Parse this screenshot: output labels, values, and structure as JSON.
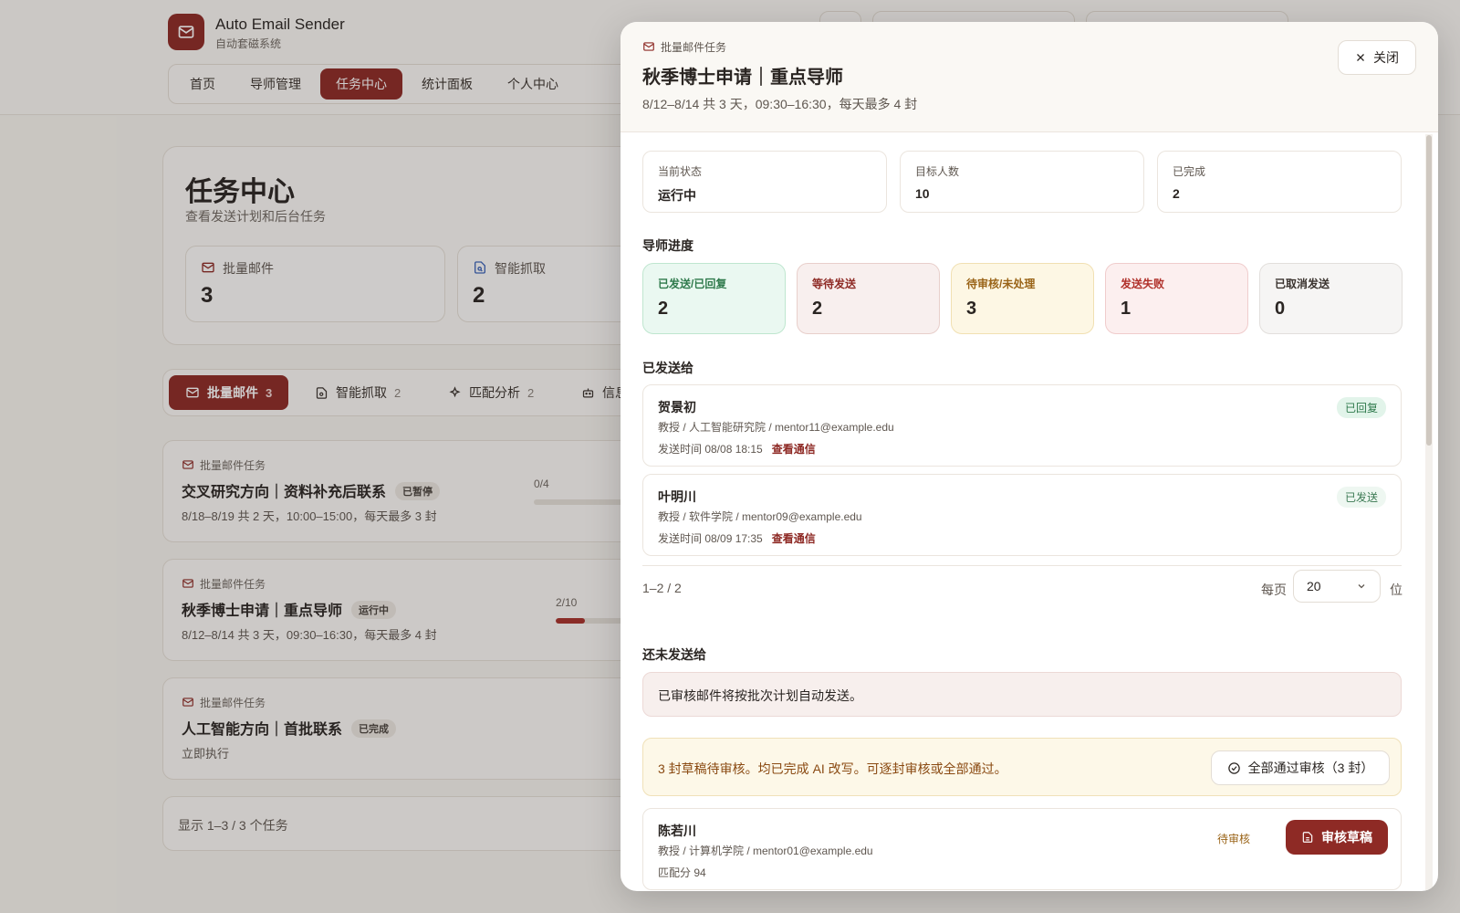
{
  "app": {
    "title": "Auto Email Sender",
    "subtitle": "自动套磁系统"
  },
  "nav": {
    "items": [
      "首页",
      "导师管理",
      "任务中心",
      "统计面板",
      "个人中心"
    ],
    "active": "任务中心"
  },
  "page": {
    "title": "任务中心",
    "subtitle": "查看发送计划和后台任务",
    "stats": [
      {
        "label": "批量邮件",
        "value": "3",
        "icon": "mail-icon"
      },
      {
        "label": "智能抓取",
        "value": "2",
        "icon": "document-search-icon"
      }
    ],
    "tabs": [
      {
        "label": "批量邮件",
        "count": "3",
        "icon": "mail-icon"
      },
      {
        "label": "智能抓取",
        "count": "2",
        "icon": "document-search-icon"
      },
      {
        "label": "匹配分析",
        "count": "2",
        "icon": "sparkle-icon"
      },
      {
        "label": "信息",
        "count": "",
        "icon": "robot-icon"
      }
    ],
    "tasks": [
      {
        "kind": "批量邮件任务",
        "title": "交叉研究方向｜资料补充后联系",
        "status": "已暂停",
        "desc": "8/18–8/19 共 2 天，10:00–15:00，每天最多 3 封",
        "progress_label": "0/4",
        "progress": 0
      },
      {
        "kind": "批量邮件任务",
        "title": "秋季博士申请｜重点导师",
        "status": "运行中",
        "desc": "8/12–8/14 共 3 天，09:30–16:30，每天最多 4 封",
        "progress_label": "2/10",
        "progress": 0.2
      },
      {
        "kind": "批量邮件任务",
        "title": "人工智能方向｜首批联系",
        "status": "已完成",
        "desc": "立即执行",
        "progress_label": "",
        "progress": 1
      }
    ],
    "pager_text": "显示 1–3 / 3 个任务"
  },
  "drawer": {
    "kind": "批量邮件任务",
    "title": "秋季博士申请｜重点导师",
    "subtitle": "8/12–8/14 共 3 天，09:30–16:30，每天最多 4 封",
    "close_label": "关闭",
    "info": [
      {
        "label": "当前状态",
        "value": "运行中"
      },
      {
        "label": "目标人数",
        "value": "10"
      },
      {
        "label": "已完成",
        "value": "2"
      }
    ],
    "progress_section_title": "导师进度",
    "progress": [
      {
        "label": "已发送/已回复",
        "value": "2",
        "bg": "#eaf8f1",
        "border": "#bfe6cf",
        "color": "#2f7a4c"
      },
      {
        "label": "等待发送",
        "value": "2",
        "bg": "#f8efee",
        "border": "#e8cfcb",
        "color": "#8e2a25"
      },
      {
        "label": "待审核/未处理",
        "value": "3",
        "bg": "#fdf7e4",
        "border": "#f1e0b2",
        "color": "#9a6418"
      },
      {
        "label": "发送失败",
        "value": "1",
        "bg": "#fcefef",
        "border": "#f0cccc",
        "color": "#b0302a"
      },
      {
        "label": "已取消发送",
        "value": "0",
        "bg": "#f6f5f4",
        "border": "#e2dfdc",
        "color": "#3a332e"
      }
    ],
    "sent_section_title": "已发送给",
    "sent": [
      {
        "name": "贺景初",
        "meta": "教授 / 人工智能研究院 / mentor11@example.edu",
        "time": "发送时间 08/08 18:15",
        "link": "查看通信",
        "tag": "已回复"
      },
      {
        "name": "叶明川",
        "meta": "教授 / 软件学院 / mentor09@example.edu",
        "time": "发送时间 08/09 17:35",
        "link": "查看通信",
        "tag": "已发送"
      }
    ],
    "pager": {
      "range": "1–2 / 2",
      "per_page_label": "每页",
      "per_page_value": "20",
      "per_page_unit": "位"
    },
    "unsent_section_title": "还未发送给",
    "note": "已审核邮件将按批次计划自动发送。",
    "warning": "3 封草稿待审核。均已完成 AI 改写。可逐封审核或全部通过。",
    "approve_all_label": "全部通过审核（3 封）",
    "pending": [
      {
        "name": "陈若川",
        "meta": "教授 / 计算机学院 / mentor01@example.edu",
        "score": "匹配分 94",
        "tag": "待审核",
        "button": "审核草稿"
      }
    ]
  }
}
